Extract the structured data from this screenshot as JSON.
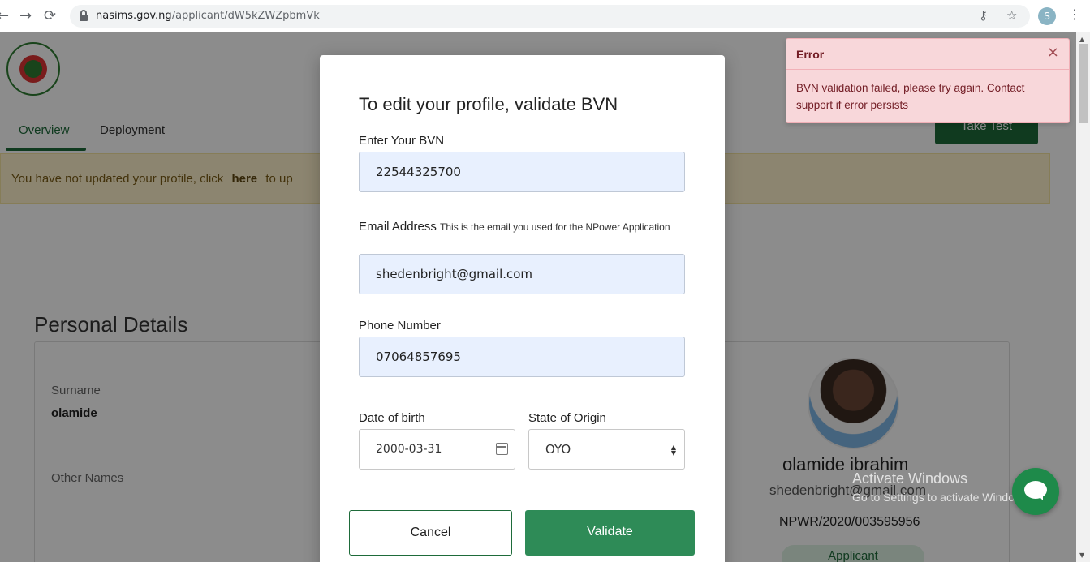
{
  "browser": {
    "url_host": "nasims.gov.ng",
    "url_path": "/applicant/dW5kZWZpbmVk",
    "back_icon": "←",
    "forward_icon": "→",
    "reload_icon": "⟳",
    "key_icon": "⚷",
    "star_icon": "☆",
    "profile_initial": "S",
    "menu_icon": "⋮"
  },
  "page": {
    "tabs": [
      "Overview",
      "Deployment"
    ],
    "notice_prefix": "You have not updated your profile, click",
    "notice_link": "here",
    "notice_suffix": "to up",
    "take_test_label": "Take Test",
    "section_title": "Personal Details",
    "fields": [
      {
        "label": "Surname",
        "value": "olamide"
      },
      {
        "label": "Other Names",
        "value": ""
      }
    ],
    "profile": {
      "name": "olamide ibrahim",
      "email": "shedenbright@gmail.com",
      "id": "NPWR/2020/003595956",
      "role": "Applicant"
    },
    "watermark_title": "Activate Windows",
    "watermark_sub": "Go to Settings to activate Windows."
  },
  "modal": {
    "title": "To edit your profile, validate BVN",
    "bvn_label": "Enter Your BVN",
    "bvn_value": "22544325700",
    "email_label": "Email Address",
    "email_hint": "This is the email you used for the NPower Application",
    "email_value": "shedenbright@gmail.com",
    "phone_label": "Phone Number",
    "phone_value": "07064857695",
    "dob_label": "Date of birth",
    "dob_value": "2000-03-31",
    "state_label": "State of Origin",
    "state_value": "OYO",
    "cancel_label": "Cancel",
    "validate_label": "Validate"
  },
  "toast": {
    "title": "Error",
    "message": "BVN validation failed, please try again. Contact support if error persists",
    "close_icon": "×"
  },
  "colors": {
    "brand_green": "#1e6b3a",
    "button_green": "#2e8b57",
    "error_bg": "#f8d7da",
    "input_bg": "#e8f0fe"
  }
}
